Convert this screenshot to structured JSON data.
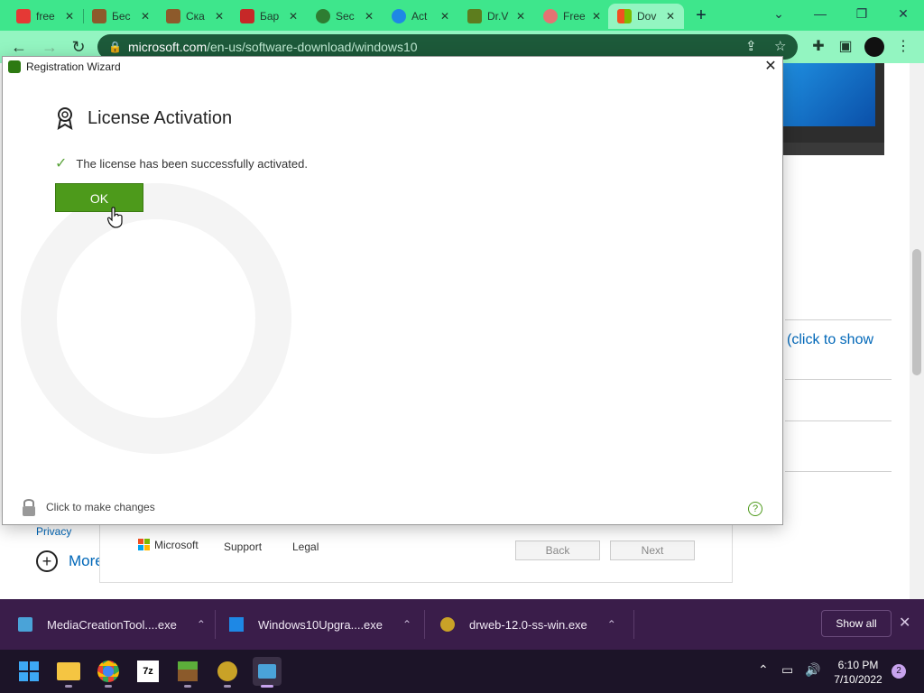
{
  "browser": {
    "tabs": [
      {
        "label": "free",
        "color": "#e53935"
      },
      {
        "label": "Бес",
        "color": "#8d5a2b"
      },
      {
        "label": "Ска",
        "color": "#8d5a2b"
      },
      {
        "label": "Бар",
        "color": "#c62828"
      },
      {
        "label": "Sec",
        "color": "#2e7d32"
      },
      {
        "label": "Act",
        "color": "#1e88e5"
      },
      {
        "label": "Dr.V",
        "color": "#5d7d1e"
      },
      {
        "label": "Free",
        "color": "#e57373"
      },
      {
        "label": "Dov",
        "color": "#f25022"
      }
    ],
    "new_tab_glyph": "+",
    "window_controls": {
      "chevron": "⌄",
      "minimize": "—",
      "restore": "❐",
      "close": "✕"
    },
    "nav": {
      "back": "←",
      "forward": "→",
      "reload": "↻"
    },
    "url_host": "microsoft.com",
    "url_path": "/en-us/software-download/windows10",
    "accent": "#3ee68c"
  },
  "webpage": {
    "link_text": "(click to show",
    "privacy": "Privacy",
    "more": "More",
    "window": {
      "brand": "Microsoft",
      "support": "Support",
      "legal": "Legal",
      "back_label": "Back",
      "next_label": "Next"
    }
  },
  "dialog": {
    "title": "Registration Wizard",
    "close_glyph": "✕",
    "heading": "License Activation",
    "status_text": "The license has been successfully activated.",
    "ok_label": "OK",
    "lock_label": "Click to make changes",
    "help_glyph": "?",
    "button_color": "#4d9a1b"
  },
  "downloads": {
    "items": [
      {
        "name": "MediaCreationTool....exe",
        "icon": "setup-icon"
      },
      {
        "name": "Windows10Upgra....exe",
        "icon": "windows-icon"
      },
      {
        "name": "drweb-12.0-ss-win.exe",
        "icon": "drweb-icon"
      }
    ],
    "chevron": "⌃",
    "show_all": "Show all",
    "close_glyph": "✕"
  },
  "taskbar": {
    "time": "6:10 PM",
    "date": "7/10/2022",
    "notifications": "2"
  }
}
